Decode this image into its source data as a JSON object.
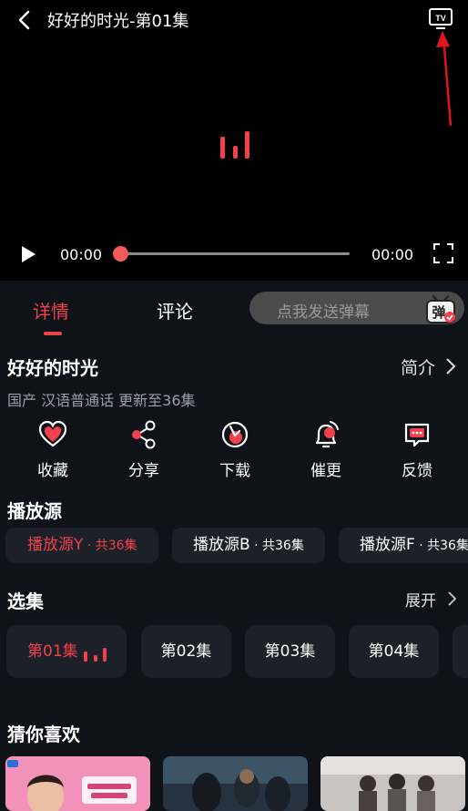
{
  "player": {
    "title": "好好的时光-第01集",
    "current_time": "00:00",
    "total_time": "00:00",
    "progress": 0
  },
  "tabs": {
    "detail": "详情",
    "comments": "评论"
  },
  "danmu": {
    "placeholder": "点我发送弹幕",
    "icon_text": "弹"
  },
  "show": {
    "name": "好好的时光",
    "intro_label": "简介",
    "meta": "国产 汉语普通话 更新至36集"
  },
  "actions": [
    {
      "label": "收藏",
      "icon": "heart-icon"
    },
    {
      "label": "分享",
      "icon": "share-icon"
    },
    {
      "label": "下载",
      "icon": "download-icon"
    },
    {
      "label": "催更",
      "icon": "bell-icon"
    },
    {
      "label": "反馈",
      "icon": "feedback-icon"
    }
  ],
  "sources": {
    "title": "播放源",
    "items": [
      {
        "name": "播放源Y",
        "count": " · 共36集"
      },
      {
        "name": "播放源B",
        "count": " · 共36集"
      },
      {
        "name": "播放源F",
        "count": " · 共36集"
      }
    ]
  },
  "episodes": {
    "title": "选集",
    "expand_label": "展开",
    "items": [
      "第01集",
      "第02集",
      "第03集",
      "第04集"
    ]
  },
  "recommend": {
    "title": "猜你喜欢"
  },
  "colors": {
    "accent": "#f2414b",
    "bg": "#0f1218",
    "pill": "#1c2029"
  }
}
